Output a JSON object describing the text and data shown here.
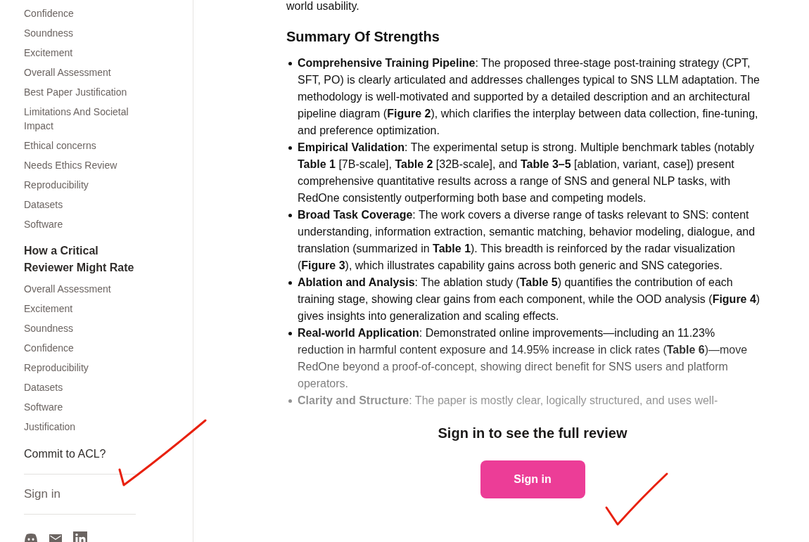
{
  "sidebar": {
    "sections": [
      {
        "items": [
          "Confidence",
          "Soundness",
          "Excitement",
          "Overall Assessment",
          "Best Paper Justification",
          "Limitations And Societal Impact",
          "Ethical concerns",
          "Needs Ethics Review",
          "Reproducibility",
          "Datasets",
          "Software"
        ]
      },
      {
        "title": "How a Critical Reviewer Might Rate",
        "items": [
          "Overall Assessment",
          "Excitement",
          "Soundness",
          "Confidence",
          "Reproducibility",
          "Datasets",
          "Software",
          "Justification"
        ]
      }
    ],
    "commit_link": "Commit to ACL?",
    "sign_in_link": "Sign in"
  },
  "main": {
    "preceding_text": "world usability.",
    "heading": "Summary Of Strengths",
    "bullets": [
      "**Comprehensive Training Pipeline**: The proposed three-stage post-training strategy (CPT, SFT, PO) is clearly articulated and addresses challenges typical to SNS LLM adaptation. The methodology is well-motivated and supported by a detailed description and an architectural pipeline diagram (**Figure 2**), which clarifies the interplay between data collection, fine-tuning, and preference optimization.",
      "**Empirical Validation**: The experimental setup is strong. Multiple benchmark tables (notably **Table 1** [7B-scale], **Table 2** [32B-scale], and **Table 3–5** [ablation, variant, case]) present comprehensive quantitative results across a range of SNS and general NLP tasks, with RedOne consistently outperforming both base and competing models.",
      "**Broad Task Coverage**: The work covers a diverse range of tasks relevant to SNS: content understanding, information extraction, semantic matching, behavior modeling, dialogue, and translation (summarized in **Table 1**). This breadth is reinforced by the radar visualization (**Figure 3**), which illustrates capability gains across both generic and SNS categories.",
      "**Ablation and Analysis**: The ablation study (**Table 5**) quantifies the contribution of each training stage, showing clear gains from each component, while the OOD analysis (**Figure 4**) gives insights into generalization and scaling effects.",
      "**Real-world Application**: Demonstrated online improvements—including an 11.23% reduction in harmful content exposure and 14.95% increase in click rates (**Table 6**)—move RedOne beyond a proof-of-concept, showing direct benefit for SNS users and platform operators.",
      "**Clarity and Structure**: The paper is mostly clear, logically structured, and uses well-"
    ],
    "gate_message": "Sign in to see the full review",
    "sign_in_button": "Sign in"
  }
}
